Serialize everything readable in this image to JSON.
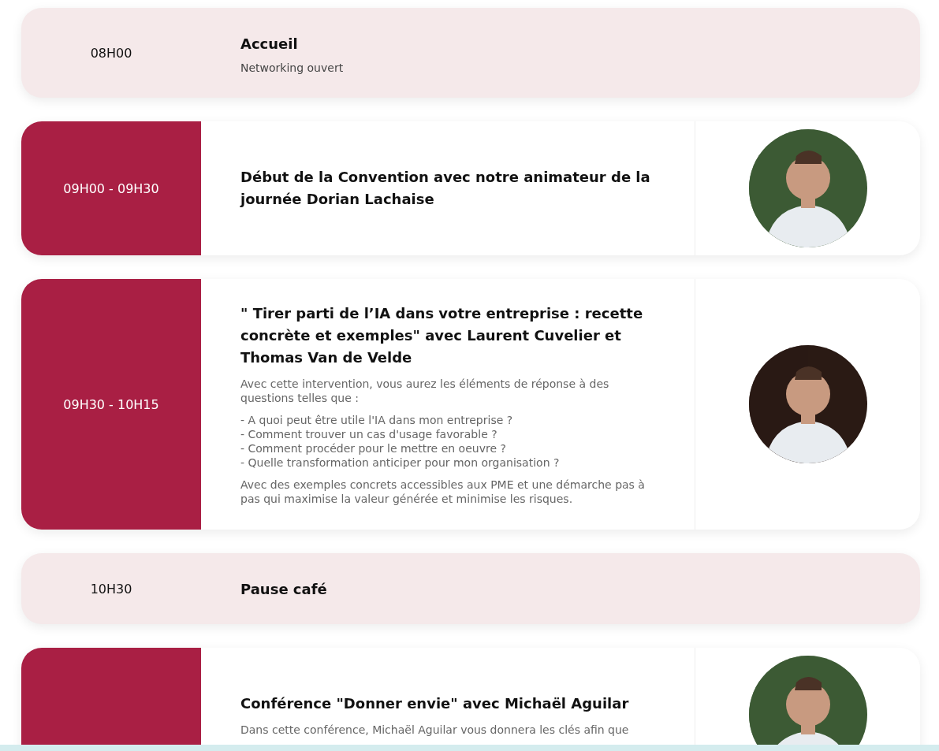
{
  "sessions": [
    {
      "kind": "break",
      "time": "08H00",
      "title": "Accueil",
      "subtitle": "Networking ouvert"
    },
    {
      "kind": "talk",
      "time": "09H00 - 09H30",
      "title": "Début de la Convention avec notre animateur de la journée Dorian Lachaise",
      "photo": {
        "kind": "picture"
      }
    },
    {
      "kind": "talk",
      "time": "09H30 - 10H15",
      "title": "\" Tirer parti de l’IA dans votre entreprise : recette concrète et exemples\" avec Laurent Cuvelier et Thomas Van de Velde",
      "intro": "Avec cette intervention, vous aurez les éléments de réponse à des questions telles que :",
      "questions": [
        "- A quoi peut être utile l'IA dans mon entreprise ?",
        "- Comment trouver un cas d'usage favorable ?",
        "- Comment procéder pour le mettre en oeuvre ?",
        "- Quelle transformation anticiper pour mon organisation ?"
      ],
      "outro": "Avec des exemples concrets accessibles aux PME et une démarche pas à pas qui maximise la valeur générée et minimise les risques.",
      "photo": {
        "kind": "picture"
      }
    },
    {
      "kind": "break",
      "time": "10H30",
      "title": "Pause café"
    },
    {
      "kind": "talk",
      "title": "Conférence \"Donner envie\" avec Michaël Aguilar",
      "intro": "Dans cette conférence, Michaël Aguilar vous donnera les clés afin que",
      "photo": {
        "kind": "picture"
      }
    }
  ]
}
